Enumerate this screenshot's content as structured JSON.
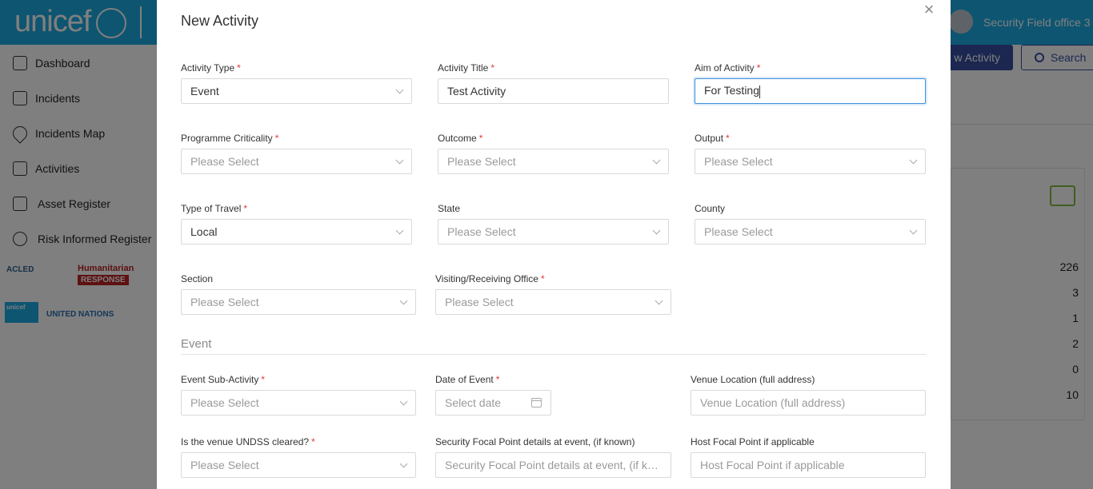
{
  "app": {
    "brand": "unicef",
    "user_name": "Security Field office 3",
    "new_activity_button": "w Activity",
    "search_button": "Search",
    "stats": [
      "226",
      "3",
      "1",
      "2",
      "0",
      "10"
    ]
  },
  "sidebar": {
    "items": [
      {
        "label": "Dashboard",
        "icon": "home-icon"
      },
      {
        "label": "Incidents",
        "icon": "incident-report-icon"
      },
      {
        "label": "Incidents Map",
        "icon": "map-pin-icon"
      },
      {
        "label": "Activities",
        "icon": "building-icon"
      },
      {
        "label": "Asset Register",
        "icon": "building-icon"
      },
      {
        "label": "Risk Informed Register",
        "icon": "info-icon"
      }
    ],
    "partners": {
      "acled": "ACLED",
      "humanitarian": "Humanitarian",
      "response": "RESPONSE",
      "unicef_small": "unicef",
      "united_nations": "UNITED NATIONS"
    }
  },
  "modal": {
    "title": "New Activity",
    "close_icon": "close-icon",
    "fields": {
      "activity_type": {
        "label": "Activity Type",
        "value": "Event"
      },
      "activity_title": {
        "label": "Activity Title",
        "value": "Test Activity"
      },
      "aim_of_activity": {
        "label": "Aim of Activity",
        "value": "For Testing"
      },
      "programme_criticality": {
        "label": "Programme Criticality",
        "placeholder": "Please Select"
      },
      "outcome": {
        "label": "Outcome",
        "placeholder": "Please Select"
      },
      "output": {
        "label": "Output",
        "placeholder": "Please Select"
      },
      "type_of_travel": {
        "label": "Type of Travel",
        "value": "Local"
      },
      "state": {
        "label": "State",
        "placeholder": "Please Select"
      },
      "county": {
        "label": "County",
        "placeholder": "Please Select"
      },
      "section": {
        "label": "Section",
        "placeholder": "Please Select"
      },
      "visiting_office": {
        "label": "Visiting/Receiving Office",
        "placeholder": "Please Select"
      }
    },
    "event_section": {
      "title": "Event",
      "fields": {
        "event_sub_activity": {
          "label": "Event Sub-Activity",
          "placeholder": "Please Select"
        },
        "date_of_event": {
          "label": "Date of Event",
          "placeholder": "Select date"
        },
        "venue_location": {
          "label": "Venue Location (full address)",
          "placeholder": "Venue Location (full address)"
        },
        "venue_undss_cleared": {
          "label": "Is the venue UNDSS cleared?",
          "placeholder": "Please Select"
        },
        "security_focal_point": {
          "label": "Security Focal Point details at event, (if known)",
          "placeholder": "Security Focal Point details at event, (if kn..."
        },
        "host_focal_point": {
          "label": "Host Focal Point if applicable",
          "placeholder": "Host Focal Point if applicable"
        }
      }
    }
  },
  "colors": {
    "brand": "#1cabe2",
    "primary_button": "#374ea2",
    "required": "#e53935",
    "focus": "#3f8fdd",
    "activity_icon": "#80bd41"
  }
}
